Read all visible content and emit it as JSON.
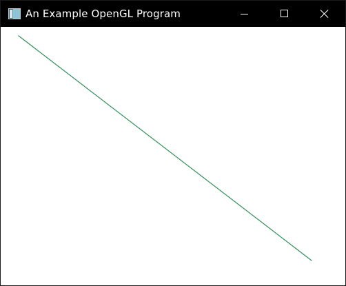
{
  "window": {
    "title": "An Example OpenGL Program",
    "icon": "app-window-icon",
    "controls": [
      {
        "name": "minimize",
        "icon": "minimize-icon"
      },
      {
        "name": "maximize",
        "icon": "maximize-icon"
      },
      {
        "name": "close",
        "icon": "close-icon"
      }
    ]
  },
  "canvas": {
    "background": "#ffffff",
    "line_color": "#2f8f5b"
  }
}
